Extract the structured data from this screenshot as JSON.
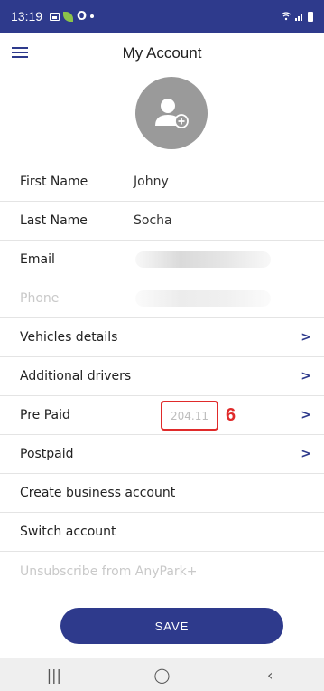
{
  "status_bar": {
    "time": "13:19",
    "icons_left": [
      "image-icon",
      "leaf-icon",
      "o-icon",
      "dot-icon"
    ],
    "icons_right": [
      "wifi-icon",
      "signal-icon",
      "battery-icon"
    ],
    "o_glyph": "O"
  },
  "header": {
    "title": "My Account"
  },
  "form": {
    "first_name_label": "First Name",
    "first_name_value": "Johny",
    "last_name_label": "Last Name",
    "last_name_value": "Socha",
    "email_label": "Email",
    "phone_label": "Phone"
  },
  "menu": {
    "vehicles_details": "Vehicles details",
    "additional_drivers": "Additional drivers",
    "pre_paid": "Pre Paid",
    "pre_paid_value": "204.11",
    "annotation_number": "6",
    "postpaid": "Postpaid",
    "create_business_account": "Create business account",
    "switch_account": "Switch account",
    "unsubscribe": "Unsubscribe from AnyPark+"
  },
  "actions": {
    "save_label": "SAVE"
  },
  "nav": {
    "recents_glyph": "|||",
    "home_glyph": "◯",
    "back_glyph": "‹"
  },
  "colors": {
    "primary": "#2e3a8c",
    "annotation": "#e02a2a",
    "avatar_bg": "#9a9a9a"
  }
}
